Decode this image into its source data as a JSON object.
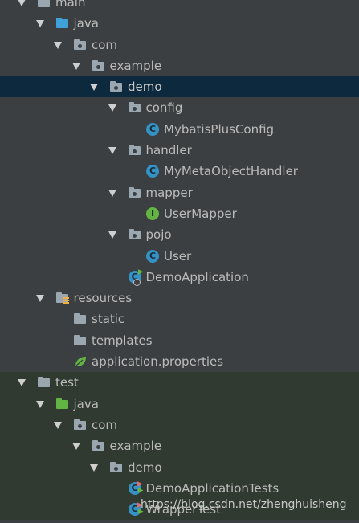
{
  "tree": [
    {
      "depth": 0,
      "label": "main",
      "icon": "folder-icon",
      "expanded": true
    },
    {
      "depth": 1,
      "label": "java",
      "icon": "source-folder-icon",
      "expanded": true
    },
    {
      "depth": 2,
      "label": "com",
      "icon": "package-icon",
      "expanded": true
    },
    {
      "depth": 3,
      "label": "example",
      "icon": "package-icon",
      "expanded": true
    },
    {
      "depth": 4,
      "label": "demo",
      "icon": "package-icon",
      "expanded": true,
      "selected": true
    },
    {
      "depth": 5,
      "label": "config",
      "icon": "package-icon",
      "expanded": true
    },
    {
      "depth": 6,
      "label": "MybatisPlusConfig",
      "icon": "class-icon"
    },
    {
      "depth": 5,
      "label": "handler",
      "icon": "package-icon",
      "expanded": true
    },
    {
      "depth": 6,
      "label": "MyMetaObjectHandler",
      "icon": "class-icon"
    },
    {
      "depth": 5,
      "label": "mapper",
      "icon": "package-icon",
      "expanded": true
    },
    {
      "depth": 6,
      "label": "UserMapper",
      "icon": "interface-icon"
    },
    {
      "depth": 5,
      "label": "pojo",
      "icon": "package-icon",
      "expanded": true
    },
    {
      "depth": 6,
      "label": "User",
      "icon": "class-icon"
    },
    {
      "depth": 5,
      "label": "DemoApplication",
      "icon": "spring-boot-class-icon"
    },
    {
      "depth": 1,
      "label": "resources",
      "icon": "resources-folder-icon",
      "expanded": true
    },
    {
      "depth": 2,
      "label": "static",
      "icon": "folder-icon"
    },
    {
      "depth": 2,
      "label": "templates",
      "icon": "folder-icon"
    },
    {
      "depth": 2,
      "label": "application.properties",
      "icon": "spring-properties-icon"
    },
    {
      "depth": 0,
      "label": "test",
      "icon": "folder-icon",
      "expanded": true,
      "test_area": true
    },
    {
      "depth": 1,
      "label": "java",
      "icon": "test-source-folder-icon",
      "expanded": true,
      "test_area": true
    },
    {
      "depth": 2,
      "label": "com",
      "icon": "package-icon",
      "expanded": true,
      "test_area": true
    },
    {
      "depth": 3,
      "label": "example",
      "icon": "package-icon",
      "expanded": true,
      "test_area": true
    },
    {
      "depth": 4,
      "label": "demo",
      "icon": "package-icon",
      "expanded": true,
      "test_area": true
    },
    {
      "depth": 5,
      "label": "DemoApplicationTests",
      "icon": "test-class-icon",
      "test_area": true
    },
    {
      "depth": 5,
      "label": "WrapperTest",
      "icon": "test-class-icon",
      "test_area": true
    }
  ],
  "watermark": "https://blog.csdn.net/zhenghuisheng"
}
